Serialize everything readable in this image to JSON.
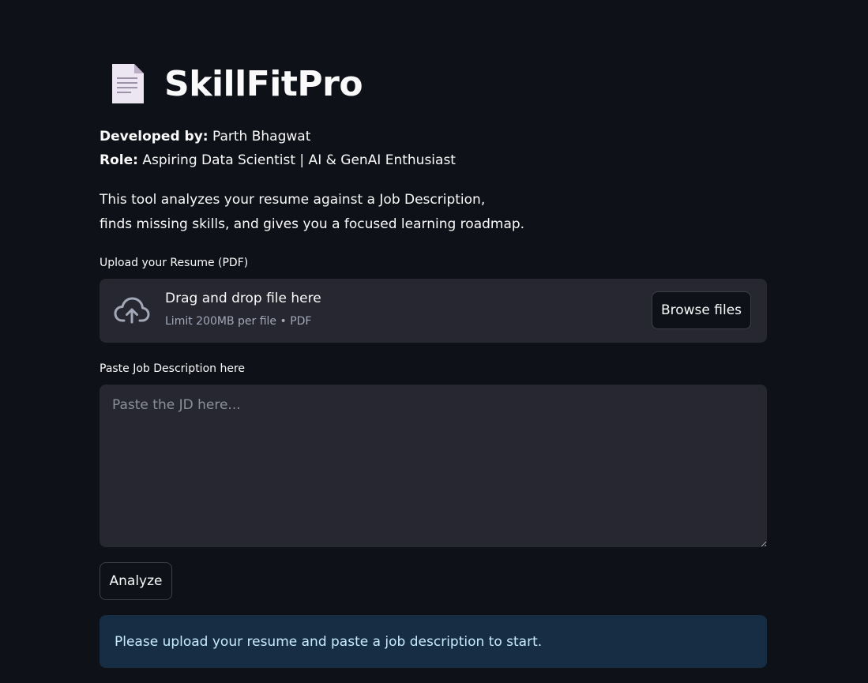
{
  "header": {
    "title": "SkillFitPro",
    "icon": "document-icon"
  },
  "developer": {
    "label": "Developed by:",
    "value": " Parth Bhagwat"
  },
  "role": {
    "label": "Role:",
    "value": " Aspiring Data Scientist | AI & GenAI Enthusiast"
  },
  "intro": {
    "line1": "This tool analyzes your resume against a Job Description,",
    "line2": "finds missing skills, and gives you a focused learning roadmap."
  },
  "upload": {
    "label": "Upload your Resume (PDF)",
    "drop_text": "Drag and drop file here",
    "limit_text": "Limit 200MB per file • PDF",
    "browse_label": "Browse files",
    "icon": "cloud-upload-icon"
  },
  "job_description": {
    "label": "Paste Job Description here",
    "placeholder": "Paste the JD here...",
    "value": ""
  },
  "analyze": {
    "label": "Analyze"
  },
  "info": {
    "message": "Please upload your resume and paste a job description to start."
  },
  "colors": {
    "background": "#0e1117",
    "widget_bg": "#262730",
    "info_bg": "#172d43",
    "info_text": "#c7ebff",
    "text": "#fafafa"
  }
}
